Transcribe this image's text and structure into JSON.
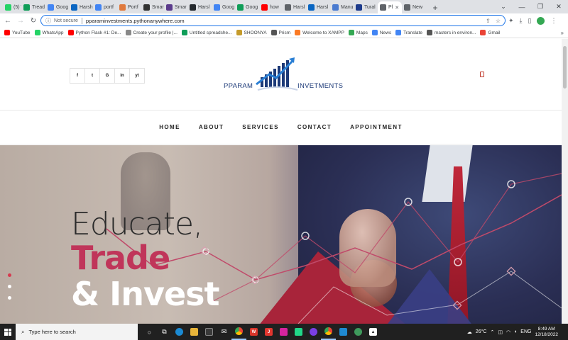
{
  "browser": {
    "tabs": [
      {
        "label": "(5) W",
        "icon": "whatsapp-icon",
        "color": "#25d366"
      },
      {
        "label": "Tread",
        "icon": "sheets-icon",
        "color": "#0f9d58"
      },
      {
        "label": "Goog",
        "icon": "google-icon",
        "color": "#4285f4"
      },
      {
        "label": "Harsh",
        "icon": "linkedin-icon",
        "color": "#0a66c2"
      },
      {
        "label": "portf",
        "icon": "google-icon",
        "color": "#4285f4"
      },
      {
        "label": "Portf",
        "icon": "site-icon",
        "color": "#e07a3e"
      },
      {
        "label": "Smar",
        "icon": "site-icon",
        "color": "#333333"
      },
      {
        "label": "Smar",
        "icon": "b-icon",
        "color": "#5b3b8c"
      },
      {
        "label": "Harsl",
        "icon": "github-icon",
        "color": "#24292e"
      },
      {
        "label": "Goog",
        "icon": "google-icon",
        "color": "#4285f4"
      },
      {
        "label": "Goog",
        "icon": "sheets-icon",
        "color": "#0f9d58"
      },
      {
        "label": "how",
        "icon": "youtube-icon",
        "color": "#ff0000"
      },
      {
        "label": "Harsl",
        "icon": "globe-icon",
        "color": "#5f6368"
      },
      {
        "label": "Harsl",
        "icon": "linkedin-icon",
        "color": "#0a66c2"
      },
      {
        "label": "Manu",
        "icon": "site-icon",
        "color": "#4a7bd0"
      },
      {
        "label": "Tural",
        "icon": "site-icon",
        "color": "#1e3c8c"
      },
      {
        "label": "Pl",
        "icon": "globe-icon",
        "color": "#5f6368",
        "active": true
      },
      {
        "label": "New",
        "icon": "chrome-icon",
        "color": "#5f6368"
      }
    ],
    "address": {
      "security": "Not secure",
      "url": "pparaminvestments.pythonanywhere.com"
    },
    "bookmarks": [
      {
        "label": "YouTube",
        "color": "#ff0000"
      },
      {
        "label": "WhatsApp",
        "color": "#25d366"
      },
      {
        "label": "Python Flask #1: De...",
        "color": "#ff0000"
      },
      {
        "label": "Create your profile |...",
        "color": "#888888"
      },
      {
        "label": "Untitled spreadshe...",
        "color": "#0f9d58"
      },
      {
        "label": "SHOONYA",
        "color": "#c59b2b"
      },
      {
        "label": "Prism",
        "color": "#555555"
      },
      {
        "label": "Welcome to XAMPP",
        "color": "#fb7a24"
      },
      {
        "label": "Maps",
        "color": "#34a853"
      },
      {
        "label": "News",
        "color": "#4285f4"
      },
      {
        "label": "Translate",
        "color": "#4285f4"
      },
      {
        "label": "masters in environ...",
        "color": "#555555"
      },
      {
        "label": "Gmail",
        "color": "#ea4335"
      }
    ]
  },
  "site": {
    "social": [
      "f",
      "t",
      "G",
      "in",
      "yt"
    ],
    "logo": {
      "left": "PPARAM",
      "right": "INVETMENTS"
    },
    "nav": [
      "HOME",
      "ABOUT",
      "SERVICES",
      "CONTACT",
      "APPOINTMENT"
    ],
    "hero": {
      "line1": "Educate,",
      "line2": "Trade",
      "line3": "& Invest"
    }
  },
  "taskbar": {
    "search_placeholder": "Type here to search",
    "weather": "26°C",
    "time": "8:49 AM",
    "date": "12/18/2022"
  }
}
